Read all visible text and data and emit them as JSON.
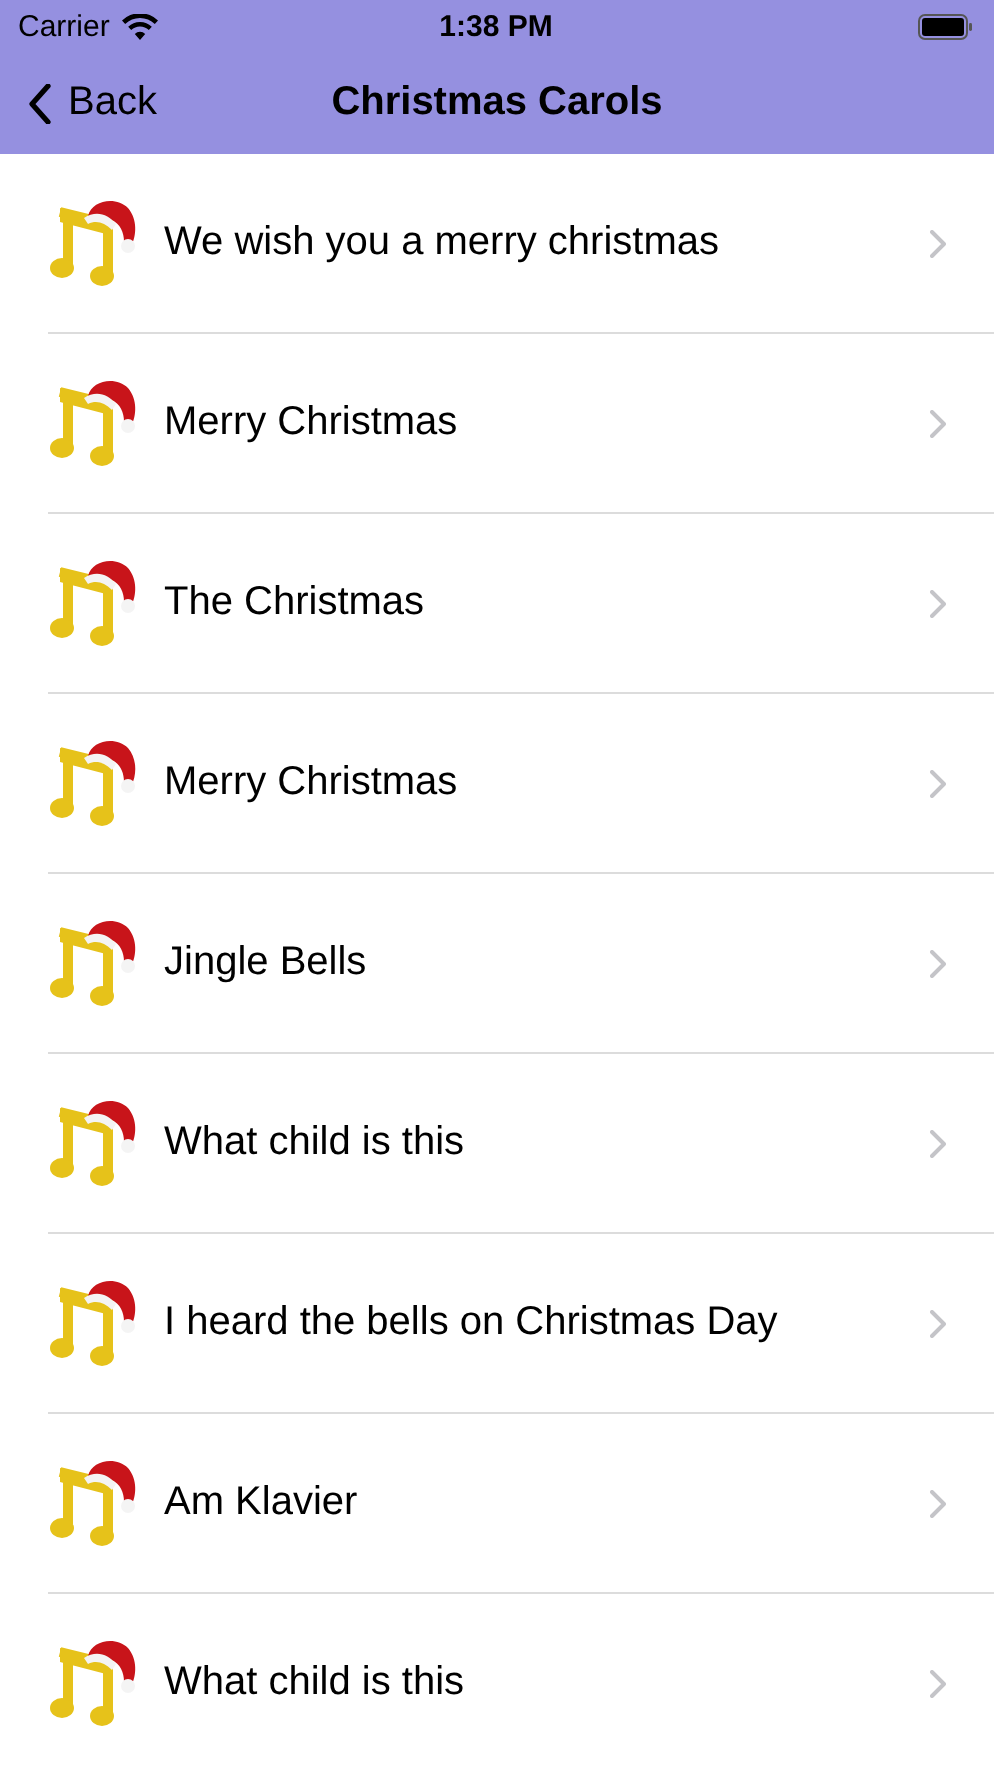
{
  "status_bar": {
    "carrier": "Carrier",
    "time": "1:38 PM"
  },
  "nav": {
    "back": "Back",
    "title": "Christmas Carols"
  },
  "songs": [
    {
      "title": "We wish you a merry christmas"
    },
    {
      "title": "Merry Christmas"
    },
    {
      "title": "The Christmas"
    },
    {
      "title": "Merry Christmas"
    },
    {
      "title": "Jingle Bells"
    },
    {
      "title": "What child is this"
    },
    {
      "title": "I heard the bells on Christmas Day"
    },
    {
      "title": "Am Klavier"
    },
    {
      "title": "What child is this"
    }
  ]
}
